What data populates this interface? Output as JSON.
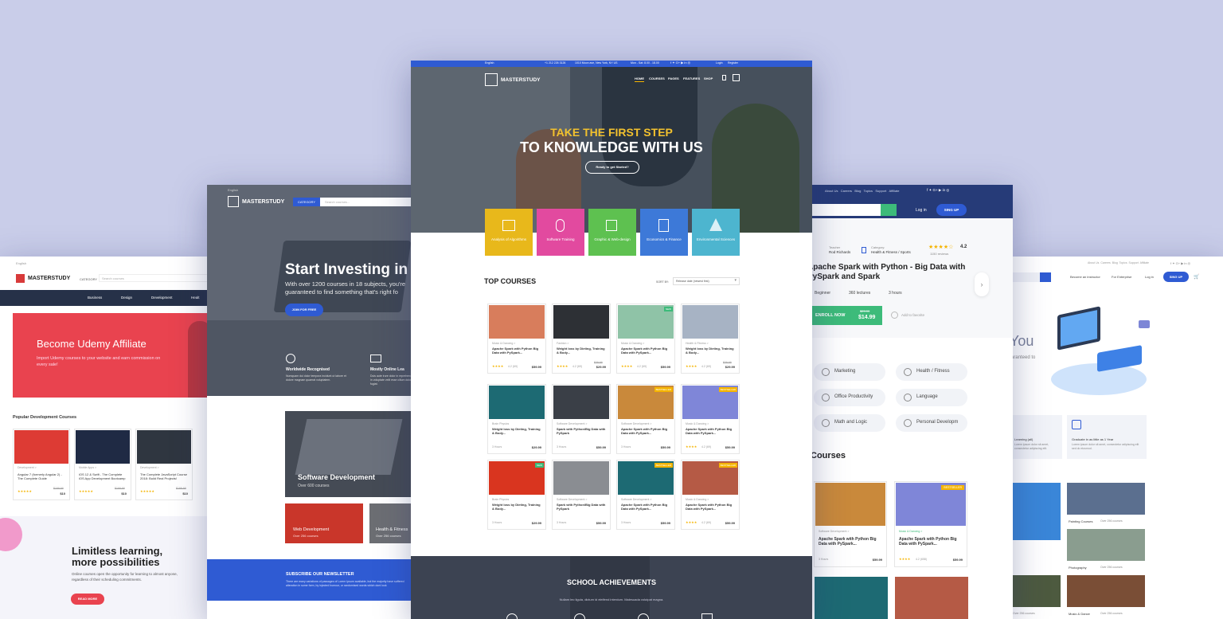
{
  "center": {
    "topbar": {
      "language": "English",
      "phone": "+1 212 226 3126",
      "address": "1010 Moon ave, New York, NY US",
      "hours": "Mon - Sat: 8.00 - 18.00",
      "login": "Login",
      "register": "Register"
    },
    "brand": "MASTERSTUDY",
    "nav": [
      "HOME",
      "COURSES",
      "PAGES",
      "FEATURES",
      "SHOP"
    ],
    "hero_line1": "TAKE THE FIRST STEP",
    "hero_line2": "TO KNOWLEDGE WITH US",
    "hero_cta": "Ready to get Started?",
    "categories": [
      {
        "label": "Analysis of Algorithms",
        "color": "#e8b81b",
        "icon": "bar-chart-icon"
      },
      {
        "label": "Software Training",
        "color": "#e24a9f",
        "icon": "mouse-icon"
      },
      {
        "label": "Graphic & Web-design",
        "color": "#5ec150",
        "icon": "cursor-icon"
      },
      {
        "label": "Economics & Finance",
        "color": "#3d79d8",
        "icon": "calculator-icon"
      },
      {
        "label": "Environmental Sciences",
        "color": "#4db5cf",
        "icon": "tree-icon"
      }
    ],
    "section_title": "TOP COURSES",
    "sort_label": "SORT BY:",
    "sort_value": "Release date (newest first)",
    "courses": [
      {
        "meta": "Music & Dancing >",
        "title": "Apache Spark with Python Big Data with PySpark...",
        "rating": "4.2 (69)",
        "price": "$59.99",
        "old": "",
        "badge": "",
        "thumb": "#d87d5c"
      },
      {
        "meta": "Fashion >",
        "title": "Weight loss by Dieting, Training & Body...",
        "rating": "4.2 (69)",
        "price": "$29.99",
        "old": "$39.99",
        "badge": "",
        "thumb": "#2d3035"
      },
      {
        "meta": "Music & Dancing >",
        "title": "Apache Spark with Python Big Data with PySpark...",
        "rating": "4.2 (69)",
        "price": "$59.99",
        "old": "",
        "badge": "NEW",
        "thumb": "#8fc3a7"
      },
      {
        "meta": "Health & Fitness >",
        "title": "Weight loss by Dieting, Training & Body...",
        "rating": "4.2 (69)",
        "price": "$29.99",
        "old": "$39.99",
        "badge": "",
        "thumb": "#a7b3c4"
      },
      {
        "meta": "Brain Physics",
        "title": "Weight loss by Dieting, Training & Body...",
        "rating": "3 Hours",
        "price": "$29.99",
        "old": "",
        "badge": "",
        "thumb": "#1d6a73"
      },
      {
        "meta": "Software Development >",
        "title": "Spark with Python/Big Data with PySpark",
        "rating": "3 Hours",
        "price": "$59.99",
        "old": "",
        "badge": "",
        "thumb": "#3a3f47"
      },
      {
        "meta": "Software Development >",
        "title": "Apache Spark with Python Big Data with PySpark...",
        "rating": "3 Hours",
        "price": "$59.99",
        "old": "",
        "badge": "BESTSELLER",
        "thumb": "#c9893b"
      },
      {
        "meta": "Music & Dancing >",
        "title": "Apache Spark with Python Big Data with PySpark...",
        "rating": "4.2 (69)",
        "price": "$59.99",
        "old": "",
        "badge": "BESTSELLER",
        "thumb": "#7f86d8"
      },
      {
        "meta": "Brain Physics",
        "title": "Weight loss by Dieting, Training & Body...",
        "rating": "3 Hours",
        "price": "$29.99",
        "old": "",
        "badge": "NEW",
        "thumb": "#d9351f"
      },
      {
        "meta": "Software Development >",
        "title": "Spark with Python/Big Data with PySpark",
        "rating": "3 Hours",
        "price": "$59.99",
        "old": "",
        "badge": "",
        "thumb": "#8a8d92"
      },
      {
        "meta": "Software Development >",
        "title": "Apache Spark with Python Big Data with PySpark...",
        "rating": "3 Hours",
        "price": "$59.99",
        "old": "",
        "badge": "BESTSELLER",
        "thumb": "#1d6a73"
      },
      {
        "meta": "Music & Dancing >",
        "title": "Apache Spark with Python Big Data with PySpark...",
        "rating": "4.2 (69)",
        "price": "$59.99",
        "old": "",
        "badge": "BESTSELLER",
        "thumb": "#b55a45"
      }
    ],
    "achievements_title": "SCHOOL ACHIEVEMENTS",
    "achievements_text": "Nullam leo ligula, dictum id eleifend interdum. Malesuada volutpat magna."
  },
  "left_mid": {
    "language": "English",
    "brand": "MASTERSTUDY",
    "category_btn": "CATEGORY",
    "search_placeholder": "Search courses...",
    "hero_title": "Start Investing in Y",
    "hero_text": "With over 1200 courses in 18 subjects, you're guaranteed to find something that's right fo",
    "hero_cta": "JOIN FOR FREE",
    "feature1_title": "Worldwide Recognised",
    "feature1_text": "Numquam dui dolor tempora incidunt ut labore et dolore magnam quaerat voluptatem.",
    "feature2_title": "Mostly Online Lea",
    "feature2_text": "Duis aute irure dolor in reprehenderit in voluptate velit esse cillum dolore eu fugiat.",
    "tile1_title": "Software Development",
    "tile1_sub": "Over 600 courses",
    "tile2_title": "Web Development",
    "tile2_sub": "Over 256 courses",
    "tile3_title": "Health & Fitness",
    "tile3_sub": "Over 256 courses",
    "newsletter_title": "SUBSCRIBE OUR NEWSLETTER",
    "newsletter_text": "There are many variations of passages of Lorem Ipsum available, but the majority have suffered alteration in some form, by injected humour, or randomised words which dont look"
  },
  "left_far": {
    "language": "English",
    "brand": "MASTERSTUDY",
    "category_btn": "CATEGORY",
    "search_placeholder": "Search courses",
    "nav": [
      "Business",
      "Design",
      "Development",
      "Healt"
    ],
    "hero_title": "Become Udemy Affiliate",
    "hero_text": "Import Udemy courses to your website and earn commission on every sale!",
    "section_title": "Popular Development Courses",
    "courses": [
      {
        "meta": "Development >",
        "title": "Angular 7 (formerly Angular 2) - The Complete Guide",
        "old": "$199.99",
        "price": "$10",
        "color": "#dd3b34"
      },
      {
        "meta": "Mobile Apps >",
        "title": "iOS 12 & Swift - The Complete iOS App Development Bootcamp",
        "old": "$199.99",
        "price": "$10",
        "color": "#1f2a44"
      },
      {
        "meta": "Development >",
        "title": "The Complete JavaScript Course 2018: Build Real Projects!",
        "old": "$199.99",
        "price": "$10",
        "color": "#2f3640"
      }
    ],
    "bottom_title_1": "Limitless learning,",
    "bottom_title_2": "more possibilities",
    "bottom_text": "Online courses open the opportunity for learning to almost anyone, regardless of their scheduling commitments.",
    "read_more": "READ MORE"
  },
  "right_mid": {
    "links": [
      "About Us",
      "Careers",
      "Blog",
      "Topics",
      "Support",
      "Affiliate"
    ],
    "login": "Log in",
    "signup": "SING UP",
    "teacher_label": "Teacher",
    "teacher_name": "Rod Richards",
    "category_label": "Category:",
    "category_value": "Health & Fitness / Sports",
    "rating": "4.2",
    "reviews": "1150 reviews",
    "title": "Apache Spark with Python - Big Data with PySpark and Spark",
    "level": "Beginner",
    "lectures": "360 lectures",
    "duration": "3 hours",
    "enroll": "ENROLL NOW",
    "price": "$14.99",
    "old_price": "$29.99",
    "favorite": "Add to favorite",
    "pills": [
      "Marketing",
      "Health / Fitness",
      "Office Productivity",
      "Language",
      "Math and Logic",
      "Personal Developm"
    ],
    "section_title": "Courses",
    "courses": [
      {
        "meta": "Software Development >",
        "title": "Apache Spark with Python Big Data with PySpark...",
        "info": "3 Hours",
        "price": "$59.99",
        "badge": "",
        "color": "#c9893b"
      },
      {
        "meta": "Music & Dancing >",
        "title": "Apache Spark with Python Big Data with PySpark...",
        "info": "4.2 (658)",
        "price": "$59.99",
        "badge": "BESTSELLER",
        "color": "#7f86d8"
      }
    ]
  },
  "right_far": {
    "links": [
      "About Us",
      "Careers",
      "Blog",
      "Topics",
      "Support",
      "Affiliate"
    ],
    "instructor": "Become an instructor",
    "enterprise": "For Enterprise",
    "login": "Log in",
    "signup": "SING UP",
    "hero_word": "You",
    "hero_sub": "aranteed to",
    "feature1_title": "Learning (all)",
    "feature1_text": "Lorem ipsum dolor sit amet, consectetur adipiscing elit.",
    "feature2_title": "Graduate in as little as 1 Year",
    "feature2_text": "Lorem ipsum dolor sit amet, consectetur adipiscing elit sed do eiusmod.",
    "tiles": [
      {
        "title": "Painting Courses",
        "sub": "Over 256 courses"
      },
      {
        "title": "Photography",
        "sub": "Over 256 courses"
      },
      {
        "title": "Music & Dance",
        "sub": "Over 256 courses"
      }
    ],
    "bottom_left": "Over 256 courses"
  }
}
